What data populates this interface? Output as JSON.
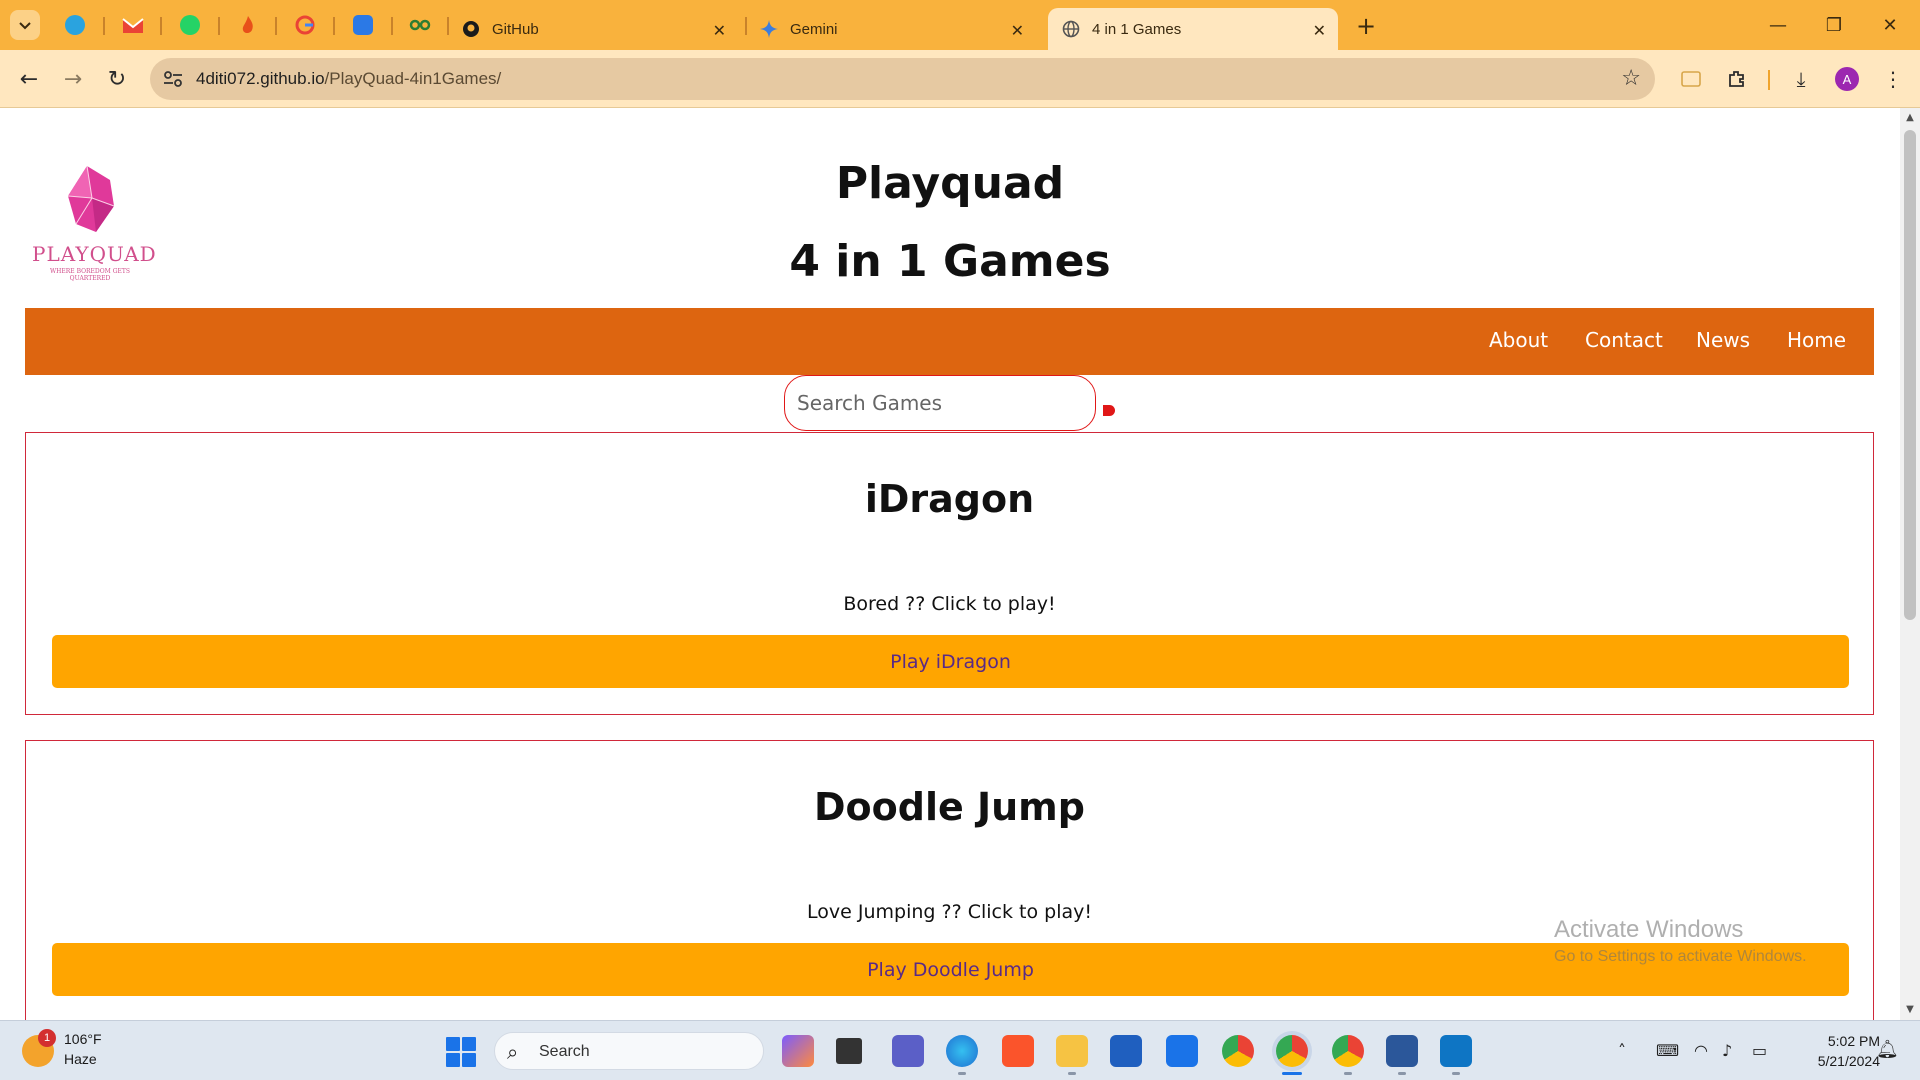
{
  "browser": {
    "tabs": [
      {
        "label": "GitHub",
        "icon": "github-icon"
      },
      {
        "label": "Gemini",
        "icon": "gemini-icon"
      },
      {
        "label": "4 in 1 Games",
        "icon": "globe-icon",
        "active": true
      }
    ],
    "pinned_tabs": [
      "telegram-icon",
      "gmail-icon",
      "whatsapp-icon",
      "flame-icon",
      "google-icon",
      "help-icon",
      "link-icon"
    ],
    "url_host": "4diti072.github.io",
    "url_path": "/PlayQuad-4in1Games/",
    "colors": {
      "tabstrip": "#f9b23d",
      "toolbar": "#ffe7bf",
      "omnibox": "#e6c9a2"
    },
    "profile_initial": "A"
  },
  "page": {
    "logo": {
      "text": "PLAYQUAD",
      "tagline": "WHERE BOREDOM GETS QUARTERED"
    },
    "title": "Playquad",
    "subtitle": "4 in 1 Games",
    "nav": [
      "About",
      "Contact",
      "News",
      "Home"
    ],
    "search_placeholder": "Search Games",
    "games": [
      {
        "title": "iDragon",
        "desc": "Bored ?? Click to play!",
        "button": "Play iDragon"
      },
      {
        "title": "Doodle Jump",
        "desc": "Love Jumping ?? Click to play!",
        "button": "Play Doodle Jump"
      }
    ],
    "colors": {
      "navbar": "#dd6510",
      "play_button": "#ffa500",
      "card_border": "#d0283a"
    }
  },
  "watermark": {
    "line1": "Activate Windows",
    "line2": "Go to Settings to activate Windows."
  },
  "taskbar": {
    "weather_temp": "106°F",
    "weather_cond": "Haze",
    "weather_badge": "1",
    "search_label": "Search",
    "time": "5:02 PM",
    "date": "5/21/2024"
  }
}
